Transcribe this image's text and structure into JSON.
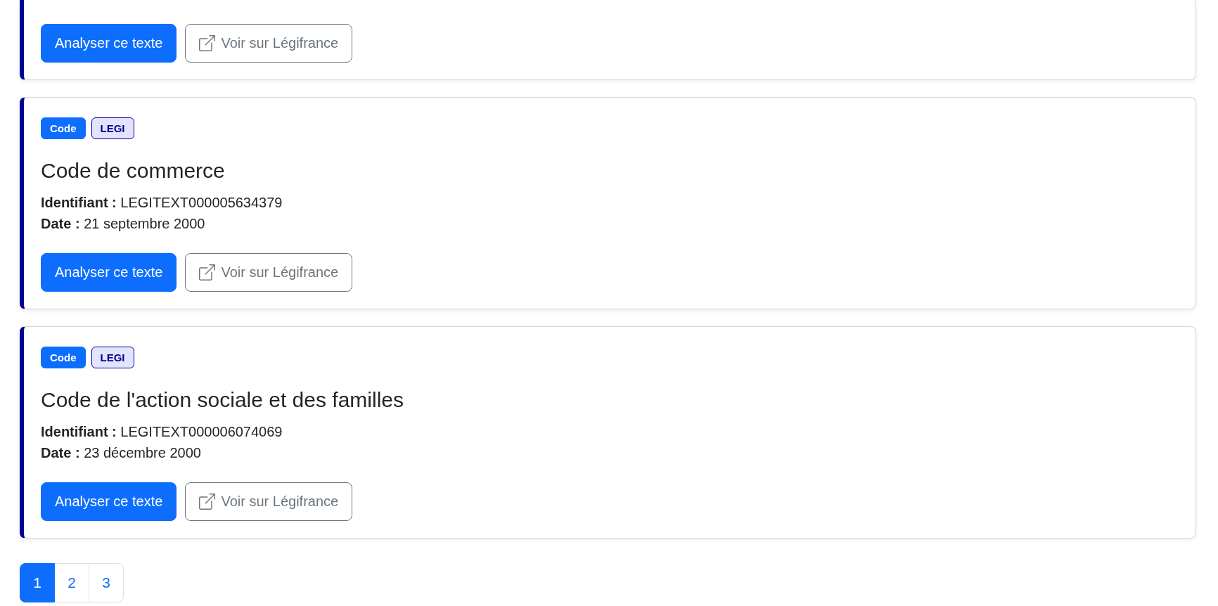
{
  "results": [
    {
      "buttons": [
        {
          "kind": "primary",
          "label": "Analyser ce texte"
        },
        {
          "kind": "external",
          "label": "Voir sur Légifrance"
        }
      ]
    },
    {
      "badges": [
        {
          "kind": "type",
          "label": "Code"
        },
        {
          "kind": "source",
          "label": "LEGI"
        }
      ],
      "title": "Code de commerce",
      "details": [
        "**Identifiant :** LEGITEXT000005634379",
        "**Date :** 21 septembre 2000"
      ],
      "buttons": [
        {
          "kind": "primary",
          "label": "Analyser ce texte"
        },
        {
          "kind": "external",
          "label": "Voir sur Légifrance"
        }
      ]
    },
    {
      "badges": [
        {
          "kind": "type",
          "label": "Code"
        },
        {
          "kind": "source",
          "label": "LEGI"
        }
      ],
      "title": "Code de l'action sociale et des familles",
      "details": [
        "**Identifiant :** LEGITEXT000006074069",
        "**Date :** 23 décembre 2000"
      ],
      "buttons": [
        {
          "kind": "primary",
          "label": "Analyser ce texte"
        },
        {
          "kind": "external",
          "label": "Voir sur Légifrance"
        }
      ]
    }
  ],
  "pagination": [
    {
      "label": "1",
      "selected": true
    },
    {
      "label": "2",
      "selected": false
    },
    {
      "label": "3",
      "selected": false
    }
  ]
}
